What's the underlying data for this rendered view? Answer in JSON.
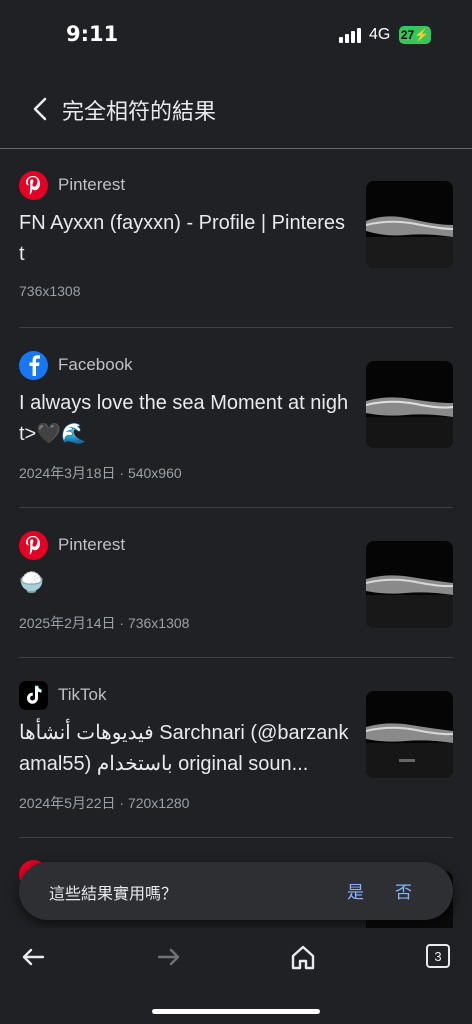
{
  "status_bar": {
    "time": "9:11",
    "network": "4G",
    "battery": "27"
  },
  "header": {
    "title": "完全相符的結果"
  },
  "results": [
    {
      "source": "Pinterest",
      "icon": "pinterest-icon",
      "title": "FN Ayxxn (fayxxn) - Profile | Pinterest",
      "meta": "736x1308"
    },
    {
      "source": "Facebook",
      "icon": "facebook-icon",
      "title": "I always love the sea Moment at night>🖤🌊",
      "meta": "2024年3月18日 · 540x960"
    },
    {
      "source": "Pinterest",
      "icon": "pinterest-icon",
      "title": "🍚",
      "meta": "2025年2月14日 · 736x1308"
    },
    {
      "source": "TikTok",
      "icon": "tiktok-icon",
      "title": "فيديوهات أنشأها Sarchnari (@barzankamal55) باستخدام original soun...",
      "meta": "2024年5月22日 · 720x1280"
    }
  ],
  "feedback": {
    "question": "這些結果實用嗎？",
    "yes": "是",
    "no": "否"
  },
  "bottom_nav": {
    "tab_count": "3"
  },
  "colors": {
    "background": "#202124",
    "accent": "#8ab4f8",
    "pinterest": "#e60023",
    "facebook": "#1877f2"
  }
}
